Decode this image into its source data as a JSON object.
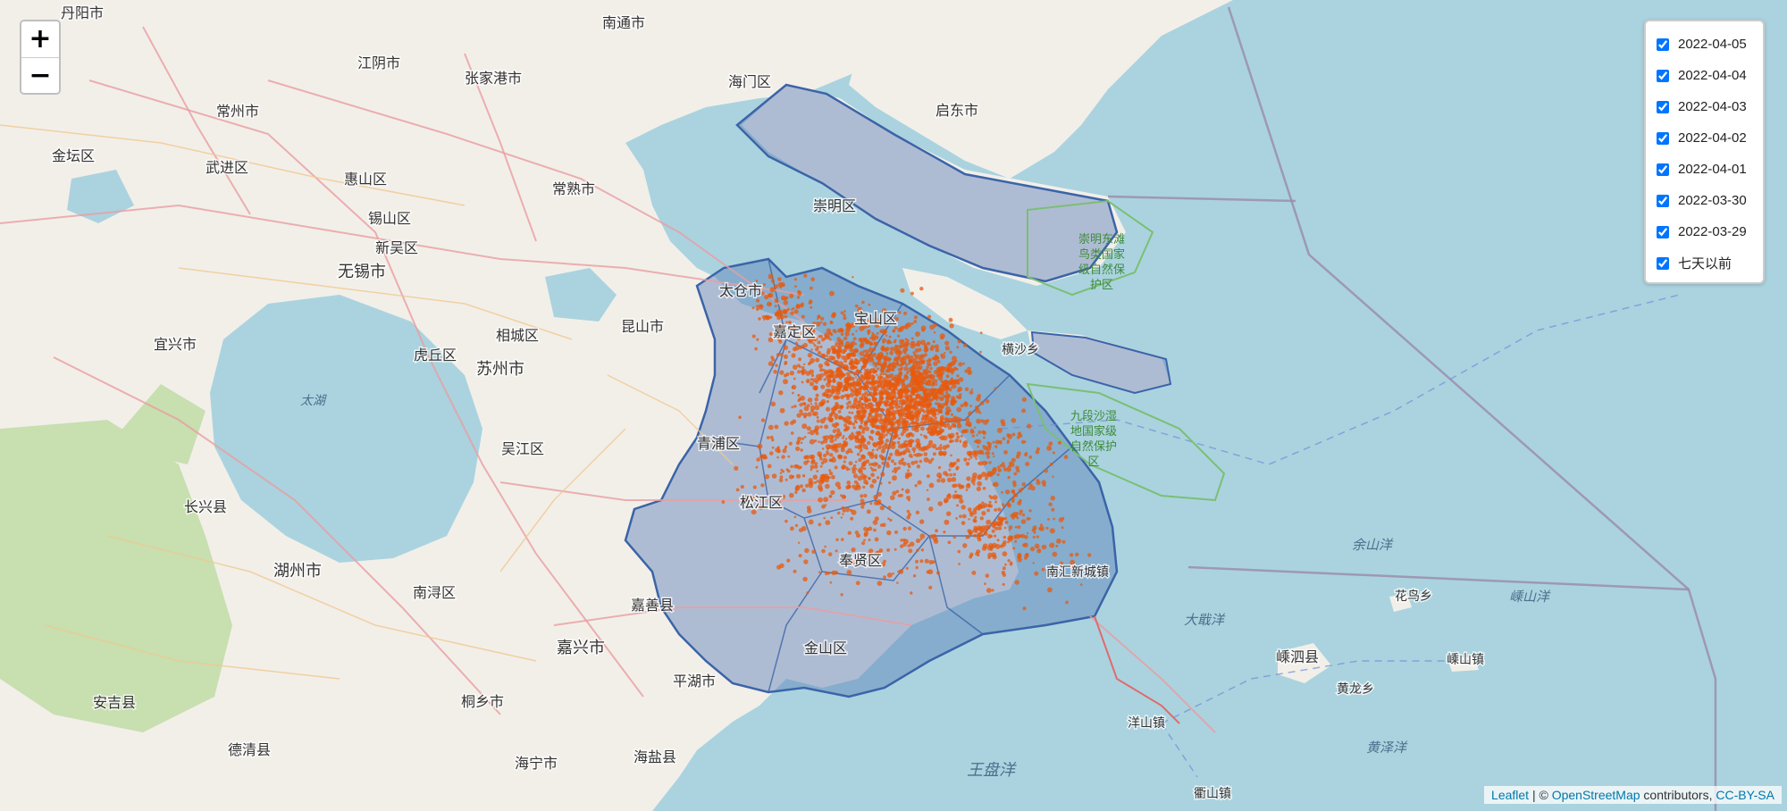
{
  "map": {
    "labels": [
      {
        "text": "丹阳市",
        "size": 16
      },
      {
        "text": "常州市",
        "size": 16
      },
      {
        "text": "金坛区",
        "size": 16
      },
      {
        "text": "武进区",
        "size": 16
      },
      {
        "text": "惠山区",
        "size": 16
      },
      {
        "text": "锡山区",
        "size": 16
      },
      {
        "text": "新吴区",
        "size": 16
      },
      {
        "text": "无锡市",
        "size": 18
      },
      {
        "text": "江阴市",
        "size": 16
      },
      {
        "text": "张家港市",
        "size": 16
      },
      {
        "text": "常熟市",
        "size": 16
      },
      {
        "text": "南通市",
        "size": 16
      },
      {
        "text": "海门区",
        "size": 16
      },
      {
        "text": "启东市",
        "size": 16
      },
      {
        "text": "崇明区",
        "size": 16
      },
      {
        "text": "太仓市",
        "size": 16
      },
      {
        "text": "昆山市",
        "size": 16
      },
      {
        "text": "相城区",
        "size": 16
      },
      {
        "text": "虎丘区",
        "size": 16
      },
      {
        "text": "苏州市",
        "size": 18
      },
      {
        "text": "吴江区",
        "size": 16
      },
      {
        "text": "宜兴市",
        "size": 16
      },
      {
        "text": "长兴县",
        "size": 16
      },
      {
        "text": "湖州市",
        "size": 18
      },
      {
        "text": "南浔区",
        "size": 16
      },
      {
        "text": "嘉善县",
        "size": 16
      },
      {
        "text": "嘉兴市",
        "size": 18
      },
      {
        "text": "桐乡市",
        "size": 16
      },
      {
        "text": "海宁市",
        "size": 16
      },
      {
        "text": "海盐县",
        "size": 16
      },
      {
        "text": "平湖市",
        "size": 16
      },
      {
        "text": "德清县",
        "size": 16
      },
      {
        "text": "安吉县",
        "size": 16
      },
      {
        "text": "嘉定区",
        "size": 16
      },
      {
        "text": "宝山区",
        "size": 16
      },
      {
        "text": "青浦区",
        "size": 16
      },
      {
        "text": "松江区",
        "size": 16
      },
      {
        "text": "奉贤区",
        "size": 16
      },
      {
        "text": "金山区",
        "size": 16
      },
      {
        "text": "南汇新城镇",
        "size": 14
      },
      {
        "text": "横沙乡",
        "size": 14
      },
      {
        "text": "太湖",
        "size": 14
      },
      {
        "text": "余山洋",
        "size": 15
      },
      {
        "text": "大戢洋",
        "size": 15
      },
      {
        "text": "嵊泗县",
        "size": 16
      },
      {
        "text": "嵊山洋",
        "size": 15
      },
      {
        "text": "黄泽洋",
        "size": 15
      },
      {
        "text": "王盘洋",
        "size": 18
      },
      {
        "text": "洋山镇",
        "size": 14
      },
      {
        "text": "花鸟乡",
        "size": 14
      },
      {
        "text": "嵊山镇",
        "size": 14
      },
      {
        "text": "黄龙乡",
        "size": 14
      },
      {
        "text": "衢山镇",
        "size": 14
      },
      {
        "text": "崇明东滩鸟类国家级自然保护区",
        "size": 13
      },
      {
        "text": "九段沙湿地国家级自然保护区",
        "size": 13
      }
    ],
    "colors": {
      "sea": "#aad3df",
      "land": "#f2efe9",
      "region_fill": "#5a7fb8",
      "cases": "#e8590c"
    }
  },
  "zoom": {
    "in_label": "+",
    "out_label": "−"
  },
  "layers": [
    {
      "label": "2022-04-05",
      "checked": true
    },
    {
      "label": "2022-04-04",
      "checked": true
    },
    {
      "label": "2022-04-03",
      "checked": true
    },
    {
      "label": "2022-04-02",
      "checked": true
    },
    {
      "label": "2022-04-01",
      "checked": true
    },
    {
      "label": "2022-03-30",
      "checked": true
    },
    {
      "label": "2022-03-29",
      "checked": true
    },
    {
      "label": "七天以前",
      "checked": true
    }
  ],
  "attribution": {
    "leaflet": "Leaflet",
    "sep": " | © ",
    "osm": "OpenStreetMap",
    "contrib": " contributors, ",
    "license": "CC-BY-SA"
  }
}
